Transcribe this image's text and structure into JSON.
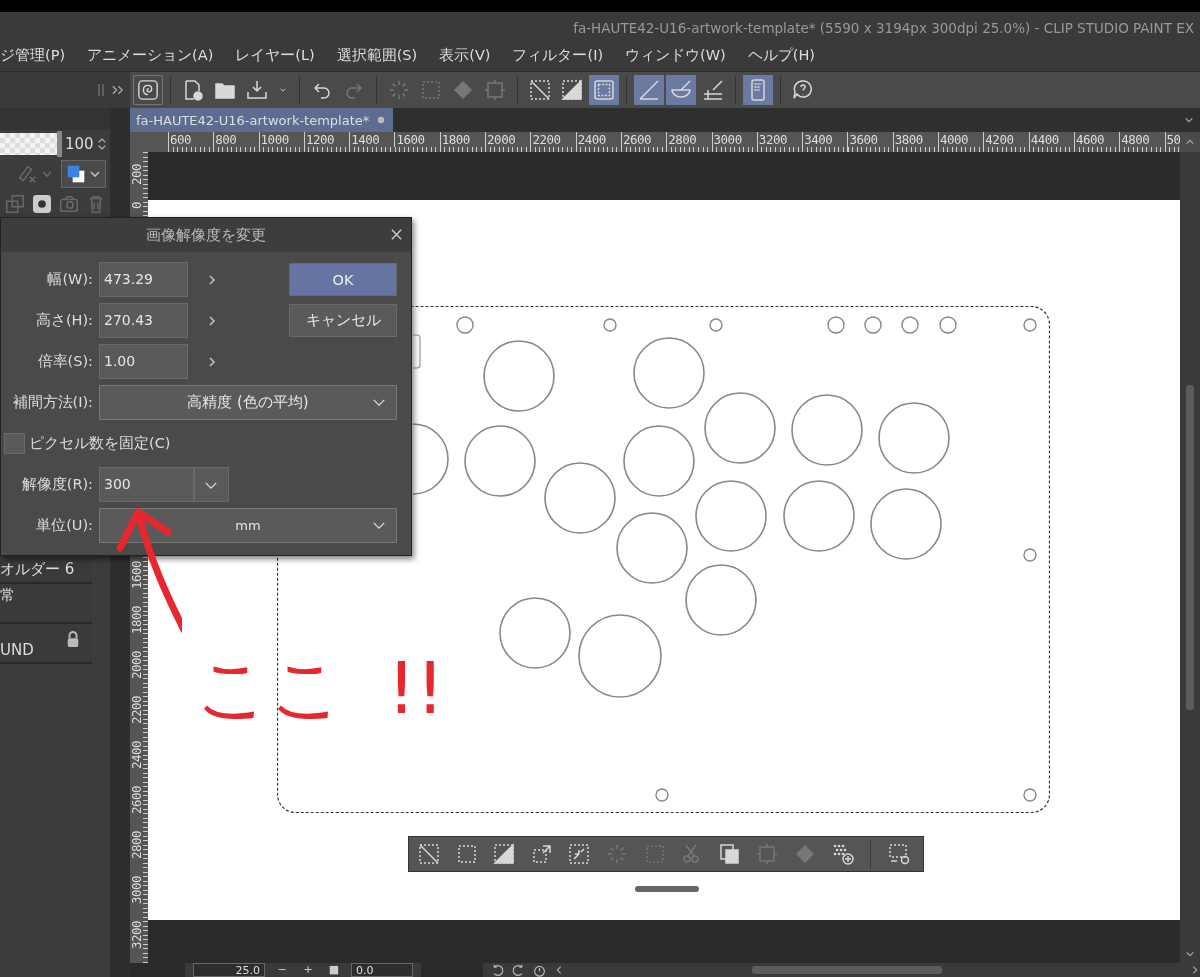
{
  "window": {
    "title": "fa-HAUTE42-U16-artwork-template* (5590 x 3194px 300dpi 25.0%)  - CLIP STUDIO PAINT EX"
  },
  "menu": [
    "ジ管理(P)",
    "アニメーション(A)",
    "レイヤー(L)",
    "選択範囲(S)",
    "表示(V)",
    "フィルター(I)",
    "ウィンドウ(W)",
    "ヘルプ(H)"
  ],
  "toolbar": {
    "groups": [
      {
        "buttons": [
          {
            "kind": "logo",
            "on": false,
            "disabled": false
          }
        ]
      },
      {
        "buttons": [
          {
            "kind": "new",
            "on": false,
            "disabled": false
          },
          {
            "kind": "open",
            "on": false,
            "disabled": false
          },
          {
            "kind": "export",
            "on": false,
            "disabled": false
          },
          {
            "kind": "caret",
            "on": false,
            "disabled": false
          }
        ]
      },
      {
        "buttons": [
          {
            "kind": "undo",
            "on": false,
            "disabled": false
          },
          {
            "kind": "redo",
            "on": false,
            "disabled": true
          }
        ]
      },
      {
        "buttons": [
          {
            "kind": "spinner",
            "on": false,
            "disabled": true
          },
          {
            "kind": "dotted-square",
            "on": false,
            "disabled": true
          },
          {
            "kind": "bucket",
            "on": false,
            "disabled": true
          },
          {
            "kind": "transform",
            "on": false,
            "disabled": true
          }
        ]
      },
      {
        "buttons": [
          {
            "kind": "clear-selection",
            "on": false,
            "disabled": false
          },
          {
            "kind": "invert",
            "on": false,
            "disabled": false
          },
          {
            "kind": "selection-border",
            "on": true,
            "disabled": false
          }
        ]
      },
      {
        "buttons": [
          {
            "kind": "ruler-snap",
            "on": true,
            "disabled": false
          },
          {
            "kind": "special-ruler-snap",
            "on": true,
            "disabled": false
          },
          {
            "kind": "grid-snap",
            "on": false,
            "disabled": false
          }
        ]
      },
      {
        "buttons": [
          {
            "kind": "device",
            "on": true,
            "disabled": false
          }
        ]
      },
      {
        "buttons": [
          {
            "kind": "help",
            "on": false,
            "disabled": false
          }
        ]
      }
    ]
  },
  "tabs": [
    {
      "label": "fa-HAUTE42-U16-artwork-template*",
      "selected": true,
      "modified": true
    }
  ],
  "ruler_top": {
    "labels": [
      "600",
      "800",
      "1000",
      "1200",
      "1400",
      "1600",
      "1800",
      "2000",
      "2200",
      "2400",
      "2600",
      "2800",
      "3000",
      "3200",
      "3400",
      "3600",
      "3800",
      "4000",
      "4200",
      "4400",
      "4600",
      "4800",
      "50"
    ]
  },
  "ruler_left": {
    "upper_labels": [
      "200",
      "0"
    ],
    "lower_labels": [
      "1600",
      "1800",
      "2000",
      "2200",
      "2400",
      "2600",
      "2800",
      "3000",
      "3200"
    ]
  },
  "layer_panel": {
    "opacity": {
      "level": 1,
      "value": "100"
    },
    "blend_tools": [
      {
        "kind": "pen-clear",
        "disabled": true
      }
    ],
    "tools": [
      {
        "kind": "copy-layer",
        "disabled": true
      },
      {
        "kind": "mask",
        "disabled": false
      },
      {
        "kind": "camera",
        "disabled": true
      },
      {
        "kind": "trash",
        "disabled": true
      }
    ],
    "layers": [
      {
        "name": "オルダー 6",
        "locked": false
      },
      {
        "name": "常",
        "locked": false
      },
      {
        "name": "UND",
        "locked": true
      }
    ]
  },
  "dialog": {
    "title": "画像解像度を変更",
    "fields": [
      {
        "label": "幅(W):",
        "value": "473.29"
      },
      {
        "label": "高さ(H):",
        "value": "270.43"
      },
      {
        "label": "倍率(S):",
        "value": "1.00"
      }
    ],
    "buttons": [
      {
        "label": "OK",
        "kind": "primary"
      },
      {
        "label": "キャンセル",
        "kind": "secondary"
      }
    ],
    "interpolation": {
      "label": "補間方法(I):",
      "value": "高精度 (色の平均)"
    },
    "fix_pixels": {
      "label": "ピクセル数を固定(C)",
      "checked": false
    },
    "resolution": {
      "label": "解像度(R):",
      "value": "300"
    },
    "unit": {
      "label": "単位(U):",
      "value": "mm"
    }
  },
  "selection_toolbar": {
    "groups": [
      {
        "buttons": [
          {
            "kind": "clear-selection",
            "on": false,
            "disabled": false
          },
          {
            "kind": "dotted-square",
            "on": false,
            "disabled": false
          },
          {
            "kind": "invert",
            "on": false,
            "disabled": false
          },
          {
            "kind": "expand",
            "on": false,
            "disabled": false
          },
          {
            "kind": "shrink",
            "on": false,
            "disabled": false
          },
          {
            "kind": "spinner",
            "on": false,
            "disabled": true
          },
          {
            "kind": "dotted-square",
            "on": false,
            "disabled": true
          },
          {
            "kind": "cut",
            "on": false,
            "disabled": true
          },
          {
            "kind": "copy",
            "on": false,
            "disabled": false
          },
          {
            "kind": "transform",
            "on": false,
            "disabled": true
          },
          {
            "kind": "bucket",
            "on": false,
            "disabled": true
          },
          {
            "kind": "dots-add",
            "on": false,
            "disabled": false
          }
        ]
      },
      {
        "buttons": [
          {
            "kind": "settings",
            "on": false,
            "disabled": false
          }
        ]
      }
    ]
  },
  "annotation": {
    "text": "ここ !!"
  },
  "status_bar": {
    "zoom": "25.0",
    "buttons": [
      "−",
      "+",
      "■"
    ],
    "rotation": "0.0"
  }
}
